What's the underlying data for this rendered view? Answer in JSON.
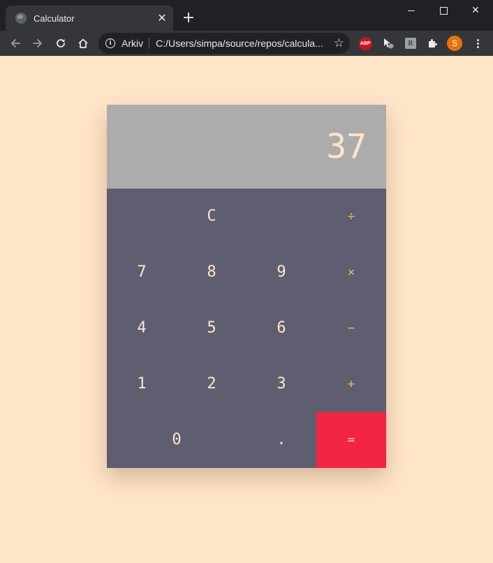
{
  "browser": {
    "tab": {
      "title": "Calculator",
      "close_glyph": "✕",
      "favicon": "globe-icon"
    },
    "new_tab_glyph": "+",
    "window_controls": {
      "close_glyph": "✕"
    },
    "omnibox": {
      "chip": "Arkiv",
      "url": "C:/Users/simpa/source/repos/calcula...",
      "info_glyph": "i",
      "star_glyph": "☆"
    },
    "extensions": {
      "abp_label": "ABP",
      "ext3_label": "R"
    },
    "profile_initial": "S",
    "colors": {
      "frame": "#202124",
      "toolbar": "#35363a",
      "avatar": "#e8710a",
      "abp": "#c5161d"
    }
  },
  "calculator": {
    "display": "37",
    "keys": {
      "clear": "C",
      "divide": "÷",
      "seven": "7",
      "eight": "8",
      "nine": "9",
      "multiply": "×",
      "four": "4",
      "five": "5",
      "six": "6",
      "subtract": "−",
      "one": "1",
      "two": "2",
      "three": "3",
      "add": "+",
      "zero": "0",
      "decimal": ".",
      "equals": "="
    },
    "colors": {
      "page_background": "#ffe5c8",
      "display_background": "#acacac",
      "keypad_background": "#5f5e70",
      "digit_text": "#ffe5c8",
      "operator_text": "#ffb84a",
      "equals_background": "#f22542"
    }
  }
}
